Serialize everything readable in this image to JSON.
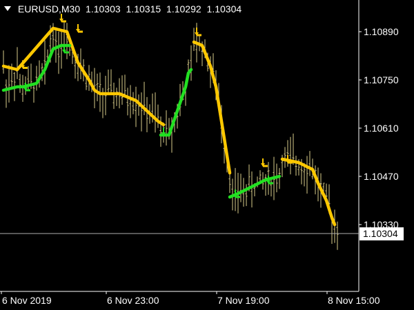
{
  "title": {
    "symbol_timeframe": "EURUSD,M30",
    "quotes": [
      "1.10303",
      "1.10315",
      "1.10292",
      "1.10304"
    ]
  },
  "colors": {
    "background": "#000000",
    "bars": "#d8cc8a",
    "axis": "#ffffff",
    "trend_down": "#ffc800",
    "trend_up": "#22e022",
    "current_price_line": "#b0b0b0"
  },
  "chart_data": {
    "type": "line",
    "xlabel": "",
    "ylabel": "",
    "ylim": [
      1.1025,
      1.1096
    ],
    "y_ticks": [
      "1.10890",
      "1.10750",
      "1.10610",
      "1.10470",
      "1.10330"
    ],
    "x_ticks": [
      {
        "label": "6 Nov 2019",
        "bar": 0
      },
      {
        "label": "6 Nov 23:00",
        "bar": 38
      },
      {
        "label": "7 Nov 19:00",
        "bar": 78
      },
      {
        "label": "8 Nov 15:00",
        "bar": 118
      }
    ],
    "current_price": "1.10304",
    "bar_count": 122,
    "series": [
      {
        "color": "#ffc800",
        "points": [
          [
            0,
            1.1079
          ],
          [
            5,
            1.1078
          ],
          [
            18,
            1.109
          ],
          [
            23,
            1.1089
          ],
          [
            27,
            1.108
          ],
          [
            31,
            1.1075
          ],
          [
            33,
            1.1072
          ],
          [
            35,
            1.1071
          ],
          [
            42,
            1.1071
          ],
          [
            48,
            1.1069
          ],
          [
            52,
            1.1066
          ],
          [
            56,
            1.1063
          ],
          [
            58,
            1.1062
          ]
        ]
      },
      {
        "color": "#22e022",
        "points": [
          [
            0,
            1.1072
          ],
          [
            5,
            1.1073
          ],
          [
            7,
            1.1073
          ],
          [
            12,
            1.1074
          ],
          [
            15,
            1.1078
          ],
          [
            18,
            1.1084
          ],
          [
            21,
            1.1085
          ],
          [
            24,
            1.1085
          ]
        ]
      },
      {
        "color": "#22e022",
        "points": [
          [
            57,
            1.1059
          ],
          [
            60,
            1.1059
          ],
          [
            63,
            1.1066
          ],
          [
            66,
            1.1073
          ],
          [
            67,
            1.1077
          ],
          [
            68,
            1.1078
          ]
        ]
      },
      {
        "color": "#ffc800",
        "points": [
          [
            69,
            1.1086
          ],
          [
            72,
            1.1085
          ],
          [
            75,
            1.1079
          ],
          [
            77,
            1.1073
          ],
          [
            79,
            1.1063
          ],
          [
            81,
            1.1053
          ],
          [
            82,
            1.1048
          ]
        ]
      },
      {
        "color": "#22e022",
        "points": [
          [
            82,
            1.1041
          ],
          [
            85,
            1.1042
          ],
          [
            90,
            1.1044
          ],
          [
            95,
            1.1046
          ],
          [
            100,
            1.1047
          ]
        ]
      },
      {
        "color": "#ffc800",
        "points": [
          [
            101,
            1.1052
          ],
          [
            107,
            1.1051
          ],
          [
            112,
            1.1049
          ],
          [
            114,
            1.1045
          ],
          [
            117,
            1.104
          ],
          [
            119,
            1.1035
          ],
          [
            120,
            1.1033
          ]
        ]
      }
    ],
    "arrows": [
      {
        "bar": 7,
        "price": 1.10795,
        "color": "#ffc800"
      },
      {
        "bar": 21,
        "price": 1.1093,
        "color": "#ffc800"
      },
      {
        "bar": 27,
        "price": 1.109,
        "color": "#ffc800"
      },
      {
        "bar": 70,
        "price": 1.1089,
        "color": "#ffc800"
      },
      {
        "bar": 94,
        "price": 1.1051,
        "color": "#ffc800"
      },
      {
        "bar": 103,
        "price": 1.1052,
        "color": "#ffc800"
      },
      {
        "bar": 8,
        "price": 1.1073,
        "color": "#22e022"
      },
      {
        "bar": 22,
        "price": 1.1084,
        "color": "#22e022"
      },
      {
        "bar": 58,
        "price": 1.106,
        "color": "#22e022"
      },
      {
        "bar": 84,
        "price": 1.1042,
        "color": "#22e022"
      },
      {
        "bar": 96,
        "price": 1.1046,
        "color": "#22e022"
      }
    ]
  }
}
